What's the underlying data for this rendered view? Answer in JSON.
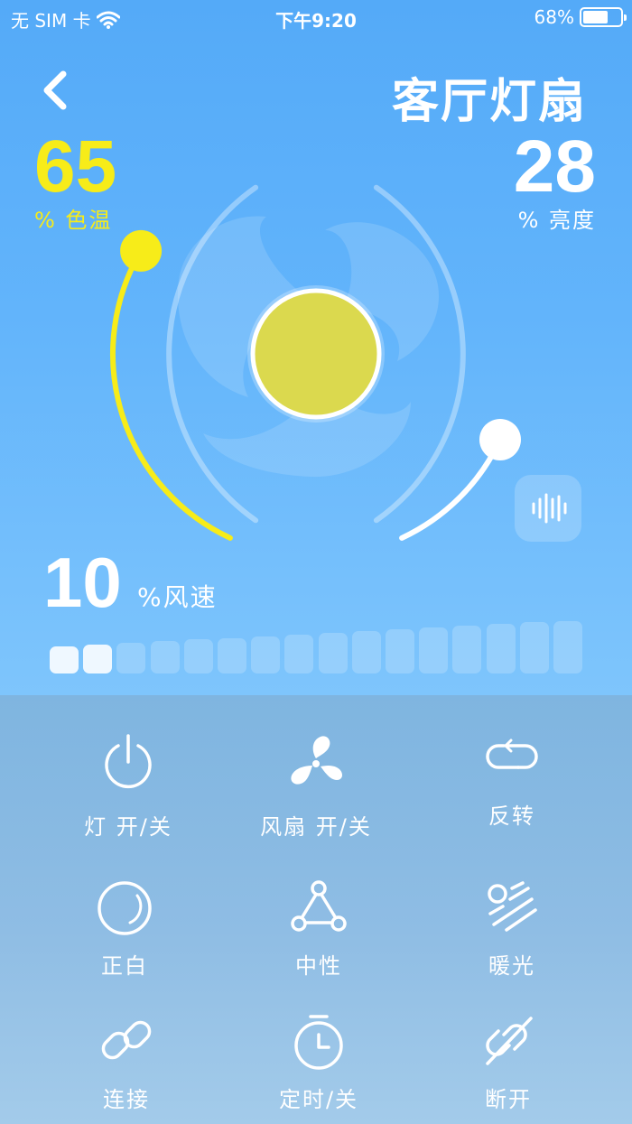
{
  "status_bar": {
    "carrier": "无 SIM 卡",
    "time": "下午9:20",
    "battery": "68%",
    "battery_level": 0.68
  },
  "header": {
    "title": "客厅灯扇",
    "back_icon": "chevron-left-icon"
  },
  "color_temp": {
    "value": "65",
    "label": "% 色温",
    "level": 0.65,
    "color": "#f7ec19"
  },
  "brightness": {
    "value": "28",
    "label": "% 亮度",
    "level": 0.28
  },
  "fan_speed": {
    "value": "10",
    "label": "%风速",
    "level": 0.1,
    "segments": 16
  },
  "controls": [
    {
      "label": "灯 开/关",
      "icon": "power-icon"
    },
    {
      "label": "风扇 开/关",
      "icon": "fan-icon"
    },
    {
      "label": "反转",
      "icon": "reverse-icon"
    },
    {
      "label": "正白",
      "icon": "white-light-icon"
    },
    {
      "label": "中性",
      "icon": "neutral-icon"
    },
    {
      "label": "暖光",
      "icon": "warm-light-icon"
    },
    {
      "label": "连接",
      "icon": "link-icon"
    },
    {
      "label": "定时/关",
      "icon": "timer-icon"
    },
    {
      "label": "断开",
      "icon": "unlink-icon"
    }
  ],
  "colors": {
    "accent_yellow": "#f7ec19",
    "lamp": "#dbd94e",
    "background_top": "#54aaf8",
    "panel": "#8fbde4"
  }
}
